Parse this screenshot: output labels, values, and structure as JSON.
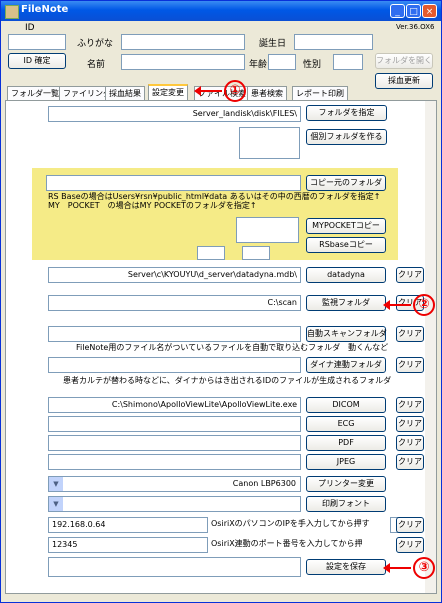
{
  "window": {
    "title": "FileNote",
    "version": "Ver.36.OX6"
  },
  "patient": {
    "id_label": "ID",
    "furigana_label": "ふりがな",
    "name_label": "名前",
    "birthday_label": "誕生日",
    "age_label": "年齢",
    "sex_label": "性別",
    "id_confirm": "ID 確定",
    "open_folder": "フォルダを開く",
    "blood_update": "採血更新"
  },
  "tabs": [
    "フォルダ一覧",
    "ファイリング",
    "採血結果",
    "設定変更",
    "ファイル検索",
    "患者検索",
    "レポート印刷"
  ],
  "settings": {
    "server_path": "Server_landisk\\disk\\FILES\\",
    "specify_folder": "フォルダを指定",
    "make_folder": "個別フォルダを作る",
    "copy_src_btn": "コピー元のフォルダ",
    "copy_note_1": "RS Baseの場合はUsers¥rsn¥public_html¥data あるいはその中の西暦のフォルダを指定↑",
    "copy_note_2": "MY　POCKET　の場合はMY POCKETのフォルダを指定↑",
    "mypocket_copy": "MYPOCKETコピー",
    "rsbase_copy": "RSbaseコピー",
    "datadyna_path": "Server\\c\\KYOUYU\\d_server\\datadyna.mdb\\",
    "datadyna_btn": "datadyna",
    "clear": "クリア",
    "watch_path": "C:\\scan",
    "watch_btn": "監視フォルダ",
    "auto_scan_btn": "自動スキャンフォルダ",
    "auto_scan_note": "FileNote用のファイル名がついているファイルを自動で取り込むフォルダ　動くんなど",
    "dyna_link_btn": "ダイナ連動フォルダ",
    "dyna_link_note": "患者カルテが替わる時などに、ダイナからはき出されるIDのファイルが生成されるフォルダ",
    "dicom_path": "C:\\Shimono\\ApolloViewLite\\ApolloViewLite.exe",
    "dicom_btn": "DICOM",
    "ecg_btn": "ECG",
    "pdf_btn": "PDF",
    "jpeg_btn": "JPEG",
    "printer_value": "Canon LBP6300",
    "printer_btn": "プリンター変更",
    "print_font_btn": "印刷フォント",
    "ip_value": "192.168.0.64",
    "ip_note": "OsiriXのパソコンのIPを手入力してから押す",
    "port_value": "12345",
    "port_note": "OsiriX連動のポート番号を入力してから押",
    "save_btn": "設定を保存"
  },
  "callouts": [
    "①",
    "②",
    "③"
  ],
  "accent_red": "#e00000"
}
